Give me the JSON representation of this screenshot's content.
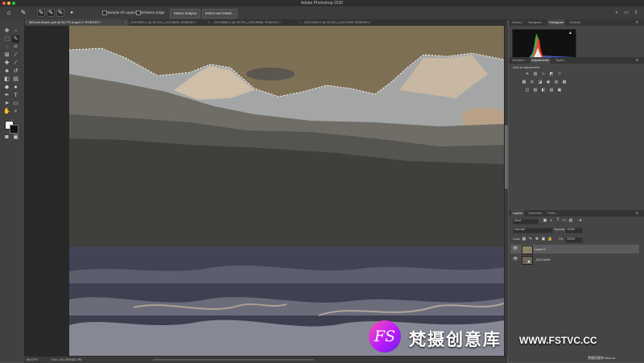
{
  "app": {
    "title": "Adobe Photoshop 2020"
  },
  "options_bar": {
    "sample_all_layers": "Sample All Layers",
    "enhance_edge": "Enhance Edge",
    "select_subject": "Select Subject",
    "select_and_mask": "Select and Mask..."
  },
  "tabs": [
    "MtCook-Beach.psd @ 66.7% (Layer 0, RGB/16*) *",
    "_DSC9633-1 @ 33.3% (_DSC9633, RGB/16*) *",
    "_DSC9686-1 @ 33.3% (_DSC9686, RGB/16*) *",
    "_DSC3499-1 @ 33.3% (_DSC3499, RGB/16*) *"
  ],
  "status": {
    "zoom": "66.67%",
    "doc": "Doc: 241.9M/482.7M"
  },
  "panels": {
    "top_tabs": [
      "History",
      "Navigator",
      "Histogram",
      "Actions"
    ],
    "mid_tabs": [
      "Libraries",
      "Adjustments",
      "Styles"
    ],
    "adjust_hint": "Add an adjustment",
    "layer_tabs": [
      "Layers",
      "Channels",
      "Paths"
    ],
    "kind": "Kind",
    "blend_mode": "Normal",
    "opacity_label": "Opacity:",
    "opacity_value": "100%",
    "lock_label": "Lock:",
    "fill_label": "Fill:",
    "fill_value": "100%",
    "layers": [
      {
        "name": "Layer 0"
      },
      {
        "name": "_DSC3499"
      }
    ]
  },
  "watermark": {
    "logo": "FS",
    "cn": "梵摄创意库",
    "url": "WWW.FSTVC.CC",
    "corner": "梵摄创意库 fstvc.cc"
  },
  "colors": {
    "ui_bg": "#535353",
    "panel": "#454545",
    "dark": "#2e2e2e",
    "accent_logo": "#c21aff"
  }
}
